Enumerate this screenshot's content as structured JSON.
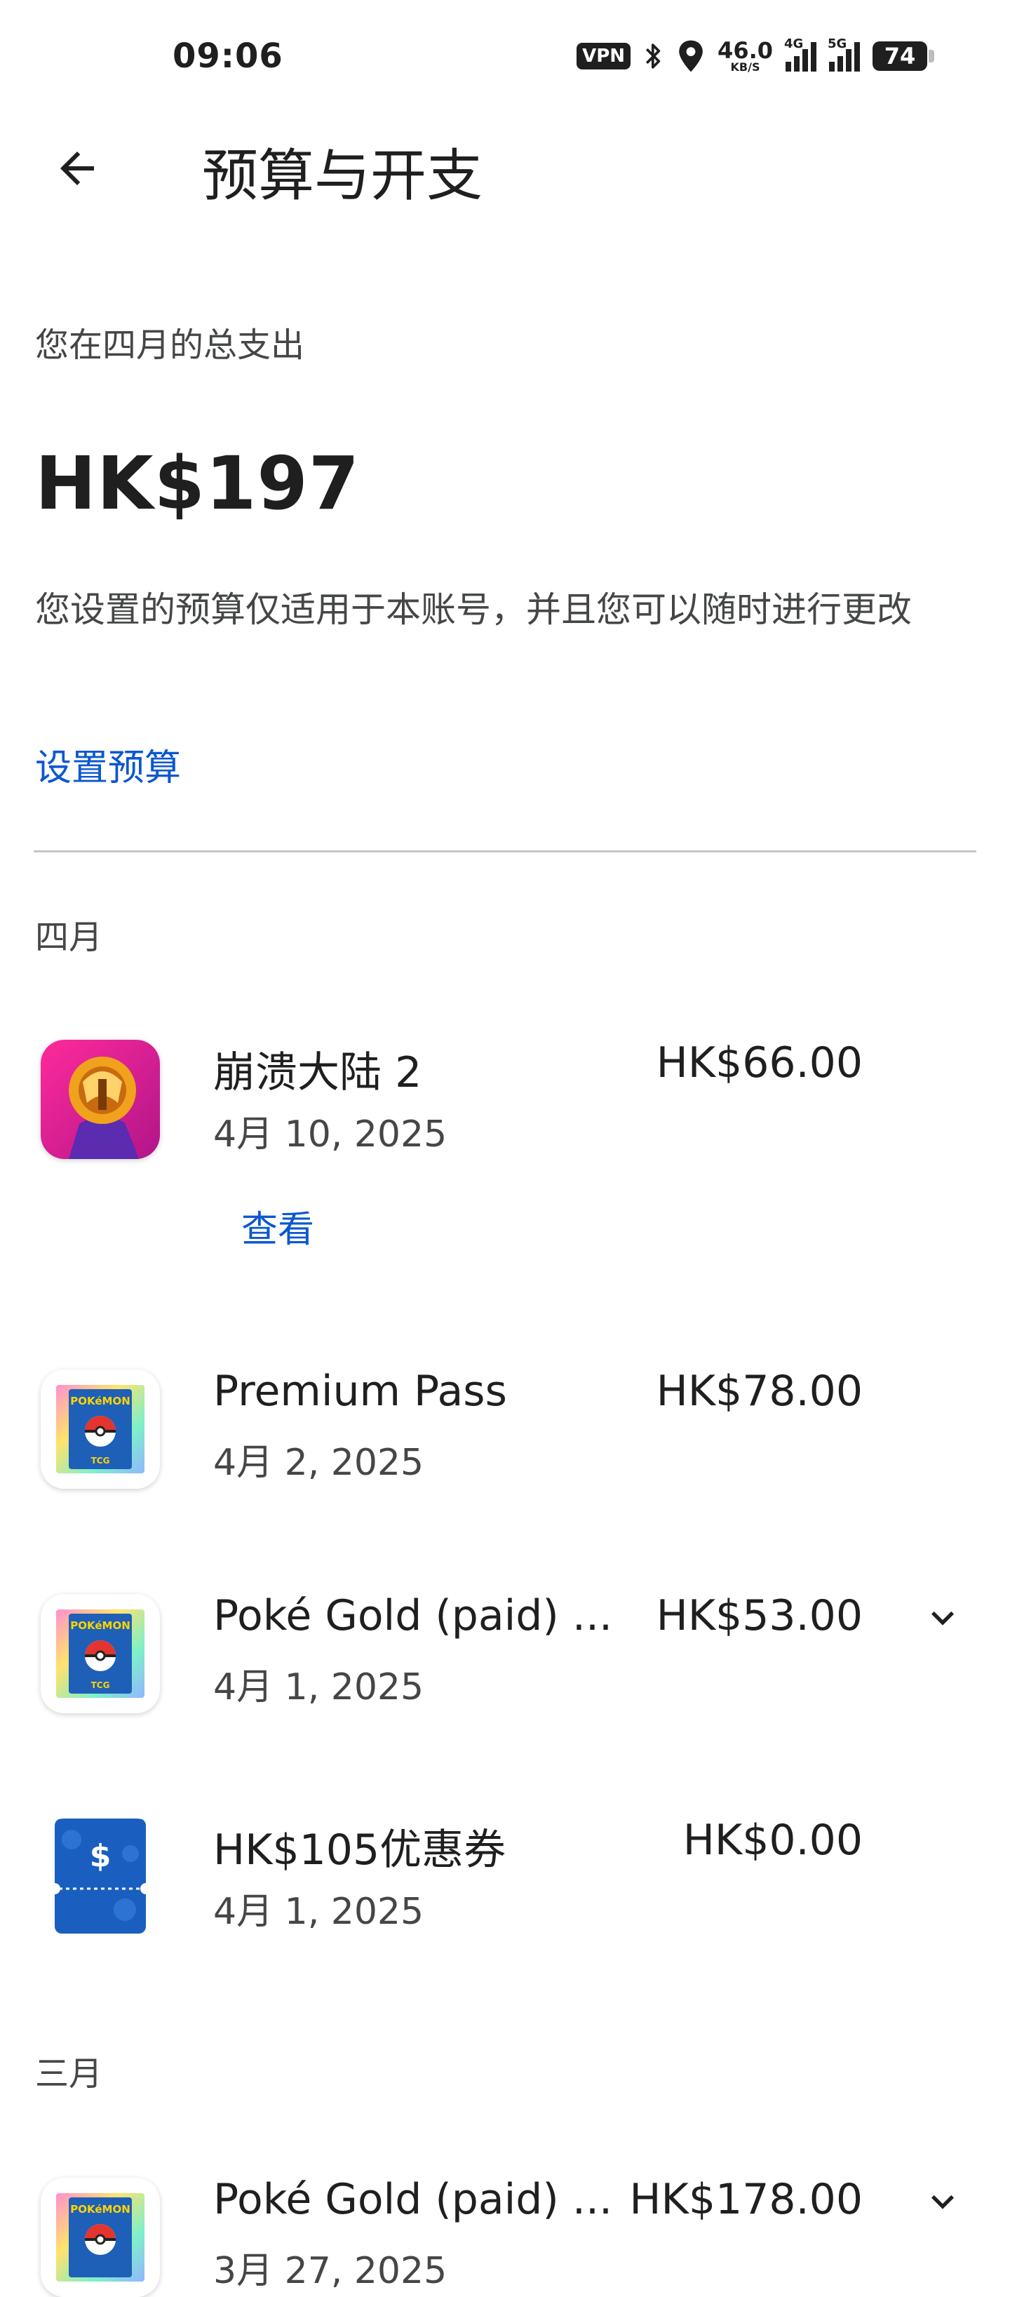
{
  "status_bar": {
    "time": "09:06",
    "vpn": "VPN",
    "net_speed": "46.0",
    "net_unit": "KB/S",
    "sig1_label": "4G",
    "sig2_label": "5G",
    "battery": "74"
  },
  "app_bar": {
    "title": "预算与开支"
  },
  "summary": {
    "caption": "您在四月的总支出",
    "total": "HK$197",
    "description": "您设置的预算仅适用于本账号，并且您可以随时进行更改",
    "set_budget_link": "设置预算"
  },
  "april": {
    "heading": "四月",
    "items": [
      {
        "title": "崩溃大陆 2",
        "date": "4月 10, 2025",
        "price": "HK$66.00",
        "action": "查看",
        "icon": "crashlands-game-icon"
      },
      {
        "title": "Premium Pass",
        "date": "4月 2, 2025",
        "price": "HK$78.00",
        "icon": "pokemon-tcg-icon"
      },
      {
        "title": "Poké Gold (paid) ...",
        "date": "4月 1, 2025",
        "price": "HK$53.00",
        "icon": "pokemon-tcg-icon"
      },
      {
        "title": "HK$105优惠券",
        "date": "4月 1, 2025",
        "price": "HK$0.00",
        "icon": "coupon-icon"
      }
    ]
  },
  "march": {
    "heading": "三月",
    "items": [
      {
        "title": "Poké Gold (paid) ...",
        "date": "3月 27, 2025",
        "price": "HK$178.00",
        "icon": "pokemon-tcg-icon"
      }
    ]
  },
  "colors": {
    "link": "#0b57d0",
    "text": "#1f1f1f",
    "secondary": "#444746",
    "divider": "#c4c7c5"
  }
}
